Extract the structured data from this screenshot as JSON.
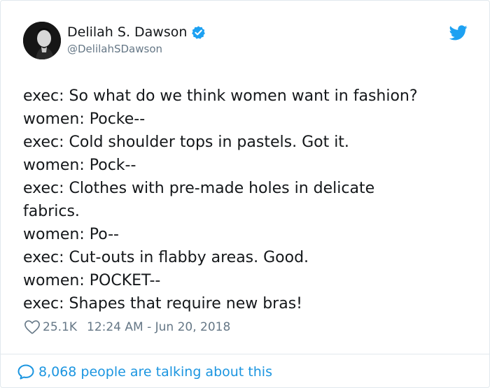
{
  "author": {
    "display_name": "Delilah S. Dawson",
    "handle": "@DelilahSDawson",
    "verified": true
  },
  "tweet": {
    "lines": [
      "exec: So what do we think women want in fashion?",
      "women: Pocke--",
      "exec: Cold shoulder tops in pastels. Got it.",
      "women: Pock--",
      "exec: Clothes with pre-made holes in delicate",
      "fabrics.",
      "women: Po--",
      "exec: Cut-outs in flabby areas. Good.",
      "women: POCKET--",
      "exec: Shapes that require new bras!"
    ]
  },
  "meta": {
    "likes": "25.1K",
    "timestamp": "12:24 AM - Jun 20, 2018"
  },
  "footer": {
    "talking_text": "8,068 people are talking about this"
  },
  "icons": {
    "verified": "verified-badge-icon",
    "bird": "twitter-bird-icon",
    "like": "heart-icon",
    "talking": "speech-bubble-icon"
  },
  "colors": {
    "accent": "#1da1f2",
    "link": "#1b95e0",
    "muted": "#657786",
    "text": "#14171a",
    "border": "#e1e8ed"
  }
}
